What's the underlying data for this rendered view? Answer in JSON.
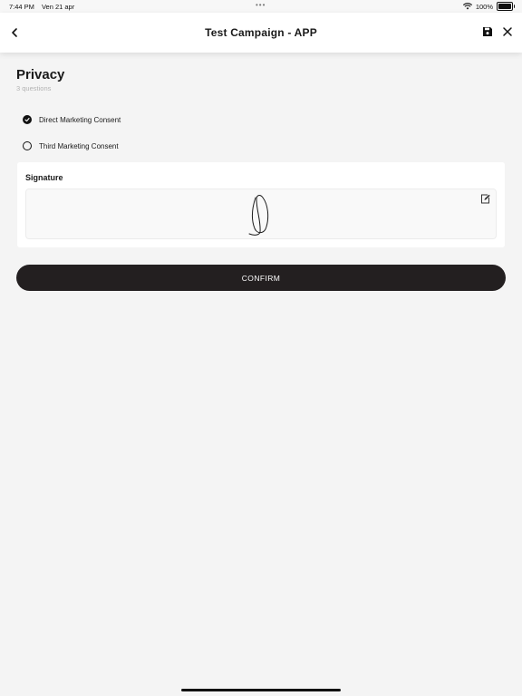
{
  "status_bar": {
    "time": "7:44 PM",
    "date": "Ven 21 apr",
    "battery": "100%"
  },
  "header": {
    "title": "Test Campaign - APP"
  },
  "section": {
    "title": "Privacy",
    "subtitle": "3 questions"
  },
  "options": [
    {
      "label": "Direct Marketing Consent",
      "checked": true
    },
    {
      "label": "Third Marketing Consent",
      "checked": false
    }
  ],
  "signature": {
    "label": "Signature"
  },
  "confirm_label": "CONFIRM",
  "icons": {
    "back": "chevron-left-icon",
    "save": "floppy-disk-icon",
    "close": "close-icon",
    "edit": "edit-icon",
    "wifi": "wifi-icon",
    "battery": "battery-icon"
  },
  "colors": {
    "background": "#f4f4f4",
    "button": "#231f20",
    "card": "#ffffff"
  }
}
